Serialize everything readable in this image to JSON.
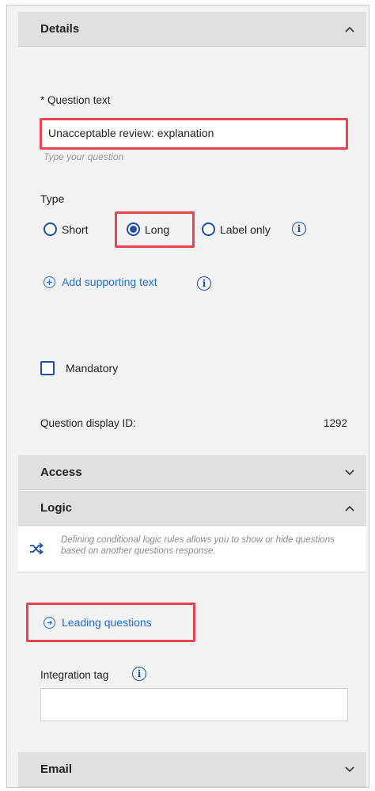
{
  "details": {
    "header": "Details",
    "question_label": "* Question text",
    "question_value": "Unacceptable review: explanation",
    "question_hint": "Type your question",
    "type_label": "Type",
    "type_options": [
      {
        "label": "Short",
        "checked": false
      },
      {
        "label": "Long",
        "checked": true
      },
      {
        "label": "Label only",
        "checked": false
      }
    ],
    "add_supporting_text": "Add supporting text",
    "mandatory_label": "Mandatory",
    "display_id_label": "Question display ID:",
    "display_id_value": "1292"
  },
  "access": {
    "header": "Access"
  },
  "logic": {
    "header": "Logic",
    "info_text": "Defining conditional logic rules allows you to show or hide questions based on another questions response.",
    "leading_questions": "Leading questions"
  },
  "integration": {
    "label": "Integration tag",
    "value": ""
  },
  "email": {
    "header": "Email"
  },
  "icons": {
    "info": "info-icon",
    "plus": "plus-circle-icon",
    "arrow": "arrow-right-circle-icon",
    "shuffle": "shuffle-icon",
    "chevron_up": "chevron-up-icon",
    "chevron_down": "chevron-down-icon"
  },
  "colors": {
    "accent": "#1e4fa3",
    "link": "#1a6fd6",
    "highlight": "#e8444f",
    "header_bg": "#e0e0e0",
    "panel_bg": "#f2f2f2"
  },
  "info_glyph": "i"
}
